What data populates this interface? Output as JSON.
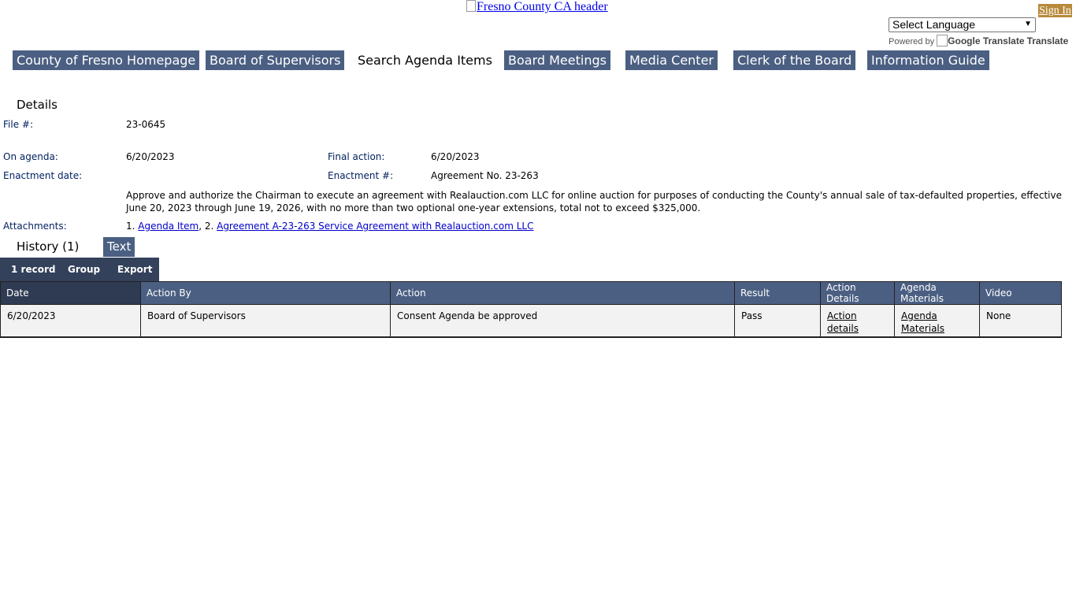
{
  "header": {
    "image_alt": "Fresno County CA header",
    "sign_in": "Sign In",
    "language_select": "Select Language",
    "powered_by": "Powered by",
    "translate_alt": "Google Translate",
    "translate_label": "Translate"
  },
  "nav": [
    {
      "label": "County of Fresno Homepage"
    },
    {
      "label": "Board of Supervisors"
    },
    {
      "label": "Search Agenda Items"
    },
    {
      "label": "Board Meetings"
    },
    {
      "label": "Media Center"
    },
    {
      "label": "Clerk of the Board"
    },
    {
      "label": "Information Guide"
    }
  ],
  "details": {
    "title": "Details",
    "file_label": "File #:",
    "file_value": "23-0645",
    "on_agenda_label": "On agenda:",
    "on_agenda_value": "6/20/2023",
    "final_action_label": "Final action:",
    "final_action_value": "6/20/2023",
    "enactment_date_label": "Enactment date:",
    "enactment_number_label": "Enactment #:",
    "enactment_number_value": "Agreement No. 23-263",
    "description": "Approve and authorize the Chairman to execute an agreement with Realauction.com LLC for online auction for purposes of conducting the County's annual sale of tax-defaulted properties, effective June 20, 2023 through June 19, 2026, with no more than two optional one-year extensions, total not to exceed $325,000.",
    "attachments_label": "Attachments:",
    "attachment_1_prefix": "1.",
    "attachment_1": "Agenda Item",
    "attachment_2_prefix": ", 2.",
    "attachment_2": "Agreement A-23-263 Service Agreement with Realauction.com LLC"
  },
  "tabs": {
    "history": "History (1)",
    "text": "Text"
  },
  "toolbar": {
    "records": "1 record",
    "group": "Group",
    "export": "Export"
  },
  "table": {
    "headers": [
      "Date",
      "Action By",
      "Action",
      "Result",
      "Action Details",
      "Agenda Materials",
      "Video"
    ],
    "rows": [
      {
        "date": "6/20/2023",
        "action_by": "Board of Supervisors",
        "action": "Consent Agenda be approved",
        "result": "Pass",
        "action_details": "Action details",
        "agenda_materials": "Agenda Materials",
        "video": "None"
      }
    ]
  },
  "colors": {
    "nav_bg": "#4b5f82",
    "toolbar_bg": "#33415a",
    "sign_in_bg": "#b78a3b",
    "label_color": "#001f5e"
  }
}
